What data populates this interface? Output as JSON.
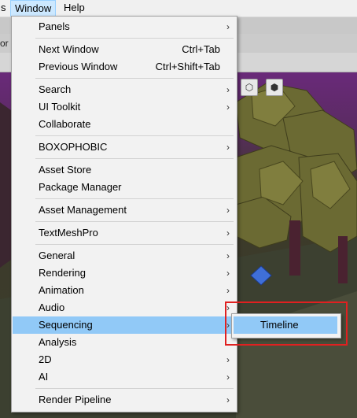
{
  "menubar": {
    "partial_item": "s",
    "window_label": "Window",
    "help_label": "Help"
  },
  "background": {
    "partial_text": "or"
  },
  "window_menu": {
    "items": [
      {
        "label": "Panels",
        "submenu": true
      },
      {
        "label": "Next Window",
        "shortcut": "Ctrl+Tab"
      },
      {
        "label": "Previous Window",
        "shortcut": "Ctrl+Shift+Tab"
      },
      {
        "label": "Search",
        "submenu": true
      },
      {
        "label": "UI Toolkit",
        "submenu": true
      },
      {
        "label": "Collaborate"
      },
      {
        "label": "BOXOPHOBIC",
        "submenu": true
      },
      {
        "label": "Asset Store"
      },
      {
        "label": "Package Manager"
      },
      {
        "label": "Asset Management",
        "submenu": true
      },
      {
        "label": "TextMeshPro",
        "submenu": true
      },
      {
        "label": "General",
        "submenu": true
      },
      {
        "label": "Rendering",
        "submenu": true
      },
      {
        "label": "Animation",
        "submenu": true
      },
      {
        "label": "Audio",
        "submenu": true
      },
      {
        "label": "Sequencing",
        "submenu": true,
        "highlighted": true
      },
      {
        "label": "Analysis"
      },
      {
        "label": "2D",
        "submenu": true
      },
      {
        "label": "AI",
        "submenu": true
      },
      {
        "label": "Render Pipeline",
        "submenu": true
      }
    ],
    "arrow_glyph": "›"
  },
  "sequencing_submenu": {
    "items": [
      {
        "label": "Timeline",
        "highlighted": true
      }
    ]
  },
  "colors": {
    "highlight": "#91c9f7",
    "annotation": "#e02020",
    "menu_bg": "#f2f2f2"
  }
}
